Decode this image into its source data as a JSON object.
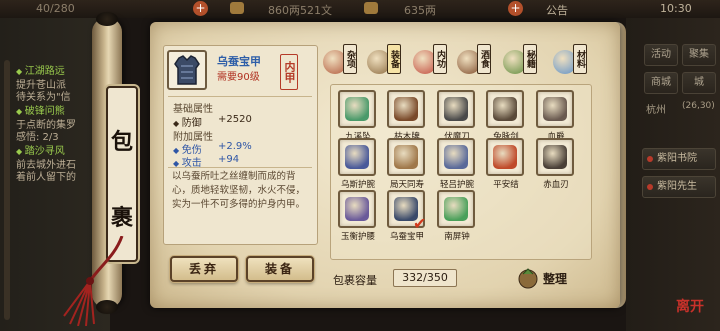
{
  "topbar": {
    "stamina": "40/280",
    "silver": "860两521文",
    "gold": "635两",
    "announcement": "公告",
    "time": "10:30"
  },
  "quests": [
    {
      "title": "江湖路远",
      "lines": [
        "提升苍山派",
        "待关系为\"信"
      ]
    },
    {
      "title": "破锋问熊",
      "lines": [
        "于点断的集罗",
        "感悟: 2/3"
      ]
    },
    {
      "title": "踏沙寻风",
      "lines": [
        "前去城外进石",
        "着前人留下的"
      ]
    }
  ],
  "panel_title": [
    "包",
    "裹"
  ],
  "selected_item": {
    "name": "乌蚕宝甲",
    "requirement": "需要90级",
    "slot_type": "内甲",
    "base_header": "基础属性",
    "base_attrs": [
      {
        "label": "防御",
        "value": "+2520"
      }
    ],
    "extra_header": "附加属性",
    "extra_attrs": [
      {
        "label": "免伤",
        "value": "+2.9%"
      },
      {
        "label": "攻击",
        "value": "+94"
      }
    ],
    "description": "以乌蚕所吐之丝缠制而成的背心，质地轻软坚韧，水火不侵，实为一件不可多得的护身内甲。"
  },
  "buttons": {
    "discard": "丢弃",
    "equip": "装备",
    "sort": "整理"
  },
  "tabs": [
    {
      "label": "杂项",
      "icon": "sundries-icon",
      "color": "#b0573a"
    },
    {
      "label": "装备",
      "icon": "equipment-icon",
      "color": "#8b6a3e"
    },
    {
      "label": "内功",
      "icon": "internal-skill-icon",
      "color": "#c0473a"
    },
    {
      "label": "酒食",
      "icon": "wine-food-icon",
      "color": "#7d4a2a"
    },
    {
      "label": "秘籍",
      "icon": "manual-icon",
      "color": "#5d8a3a"
    },
    {
      "label": "材料",
      "icon": "material-icon",
      "color": "#5b8fc8"
    }
  ],
  "active_tab": 1,
  "items": [
    {
      "name": "九溪坠",
      "icon": "pendant-icon",
      "color": "#4a9a6a"
    },
    {
      "name": "枯木牌",
      "icon": "wood-tablet-icon",
      "color": "#7a4a2a"
    },
    {
      "name": "伏魔刀",
      "icon": "saber-icon",
      "color": "#4a4a4a"
    },
    {
      "name": "兔脉剑",
      "icon": "sword-icon",
      "color": "#5a4a3a"
    },
    {
      "name": "血爵",
      "icon": "claw-icon",
      "color": "#6a5a50"
    },
    {
      "name": "乌斯护腕",
      "icon": "bracer-icon",
      "color": "#4a5a9a"
    },
    {
      "name": "局天同寿",
      "icon": "ring-icon",
      "color": "#a0784a"
    },
    {
      "name": "轻吕护腕",
      "icon": "bracer-icon",
      "color": "#5a6a9a"
    },
    {
      "name": "平安结",
      "icon": "knot-icon",
      "color": "#c04a2a"
    },
    {
      "name": "赤血刃",
      "icon": "blade-icon",
      "color": "#4a4038"
    },
    {
      "name": "玉衡护腰",
      "icon": "belt-icon",
      "color": "#6a5a9a"
    },
    {
      "name": "乌蚕宝甲",
      "icon": "armor-icon",
      "color": "#3a4a6a",
      "selected": true
    },
    {
      "name": "南屏钟",
      "icon": "bell-icon",
      "color": "#4aa05a"
    }
  ],
  "capacity": {
    "label": "包裹容量",
    "value": "332/350"
  },
  "right_panel": {
    "buttons": [
      "活动",
      "聚集",
      "商城",
      "城"
    ],
    "location": "杭州",
    "coords": "(26,30)",
    "nav": [
      "紫阳书院",
      "紫阳先生"
    ],
    "leave": "离开"
  }
}
